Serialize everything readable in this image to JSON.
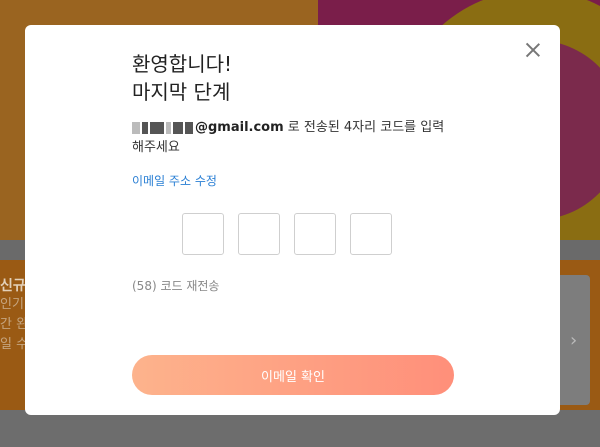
{
  "background": {
    "title": "신규",
    "lines": [
      "인기",
      "간 완",
      "일 수"
    ]
  },
  "modal": {
    "title_line1": "환영합니다!",
    "title_line2": "마지막 단계",
    "email": "@gmail.com",
    "desc_after_email": " 로 전송된 4자리 코드를 입력",
    "desc_line2": "해주세요",
    "edit_email_label": "이메일 주소 수정",
    "resend_countdown": "(58)",
    "resend_label": " 코드 재전송",
    "confirm_label": "이메일 확인",
    "code_digits": [
      "",
      "",
      "",
      ""
    ]
  },
  "colors": {
    "link": "#2a7fd4",
    "button_gradient_start": "#fdb38c",
    "button_gradient_end": "#ff8f7a"
  }
}
